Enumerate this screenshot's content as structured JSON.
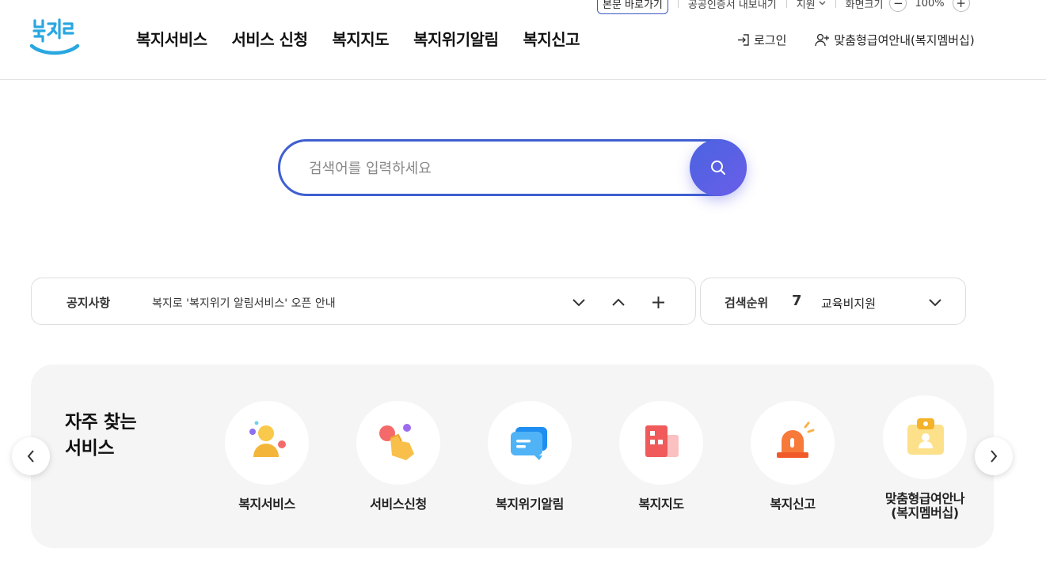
{
  "util": {
    "skip_label": "본문 바로가기",
    "item2_label": "공공인증서 내보내기",
    "lang_label": "지원",
    "zoom_label": "화면크기",
    "zoom_value": "100%",
    "zoom_minus": "−",
    "zoom_plus": "+"
  },
  "header": {
    "logo_text": "복지로",
    "nav": [
      "복지서비스",
      "서비스 신청",
      "복지지도",
      "복지위기알림",
      "복지신고"
    ],
    "login_label": "로그인",
    "membership_label": "맞춤형급여안내(복지멤버십)"
  },
  "search": {
    "placeholder": "검색어를 입력하세요"
  },
  "notice": {
    "label": "공지사항",
    "text": "복지로 '복지위기 알림서비스' 오픈 안내"
  },
  "ranking": {
    "label": "검색순위",
    "rank": "7",
    "keyword": "교육비지원"
  },
  "frequent": {
    "title_line1": "자주 찾는",
    "title_line2": "서비스",
    "items": [
      {
        "name": "복지서비스",
        "icon": "person-icon"
      },
      {
        "name": "서비스신청",
        "icon": "hand-tap-icon"
      },
      {
        "name": "복지위기알림",
        "icon": "chat-bubble-icon"
      },
      {
        "name": "복지지도",
        "icon": "building-icon"
      },
      {
        "name": "복지신고",
        "icon": "siren-icon"
      },
      {
        "name": "맞춤형급여안나",
        "name2": "(복지멤버십)",
        "icon": "id-card-icon"
      }
    ]
  },
  "colors": {
    "accent": "#3f5fd1",
    "search_button": "#5a60e4",
    "panel_bg": "#f5f5f5"
  }
}
